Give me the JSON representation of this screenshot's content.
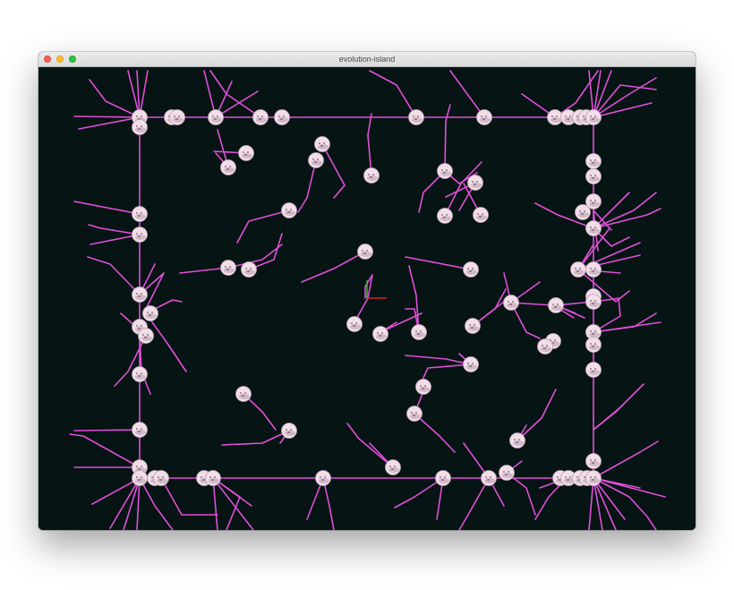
{
  "window": {
    "title": "evolution-island"
  },
  "colors": {
    "background": "#061414",
    "limb": "#e14fd8",
    "creature_body": "#f2dde8",
    "creature_face": "#5a4a58",
    "axis_x": "#d0261e",
    "axis_y": "#3fb83a"
  },
  "icons": {
    "close": "traffic-light-close",
    "minimize": "traffic-light-minimize",
    "zoom": "traffic-light-zoom"
  }
}
